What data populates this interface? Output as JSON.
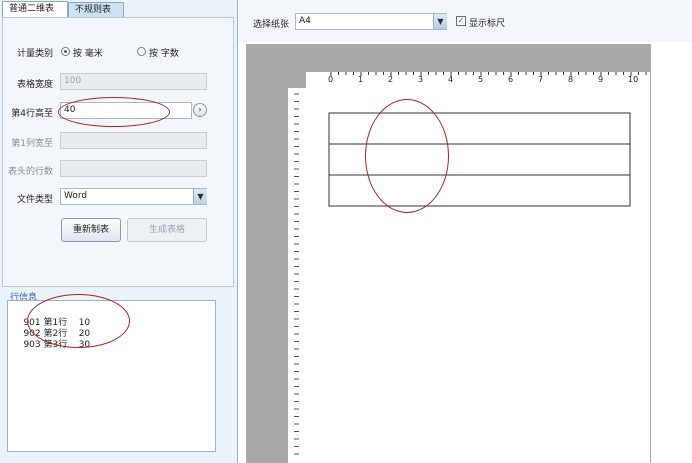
{
  "tabs": [
    {
      "label": "普通二维表"
    },
    {
      "label": "不规则表"
    }
  ],
  "form": {
    "measure_label": "计量类别",
    "radio_mm": "按  毫米",
    "radio_chars": "按  字数",
    "width_label": "表格宽度",
    "width_value": "100",
    "row_height_label": "第4行高至",
    "row_height_value": "40",
    "col_width_label": "第1列宽至",
    "header_rows_label": "表头的行数",
    "file_type_label": "文件类型",
    "file_type_value": "Word",
    "remake_button": "重新制表",
    "generate_button": "生成表格"
  },
  "row_info": {
    "title": "行信息",
    "rows": [
      {
        "id": "901",
        "name": "第1行",
        "value": "10"
      },
      {
        "id": "902",
        "name": "第2行",
        "value": "20"
      },
      {
        "id": "903",
        "name": "第3行",
        "value": "30"
      }
    ]
  },
  "toolbar": {
    "paper_label": "选择纸张",
    "paper_value": "A4",
    "show_ruler_label": "显示标尺"
  },
  "ruler": {
    "ticks": [
      "0",
      "1",
      "2",
      "3",
      "4",
      "5",
      "6",
      "7",
      "8",
      "9",
      "10"
    ]
  },
  "colors": {
    "annotation": "#b22222",
    "canvas": "#a9a9a9",
    "panel": "#eaf2fa"
  }
}
